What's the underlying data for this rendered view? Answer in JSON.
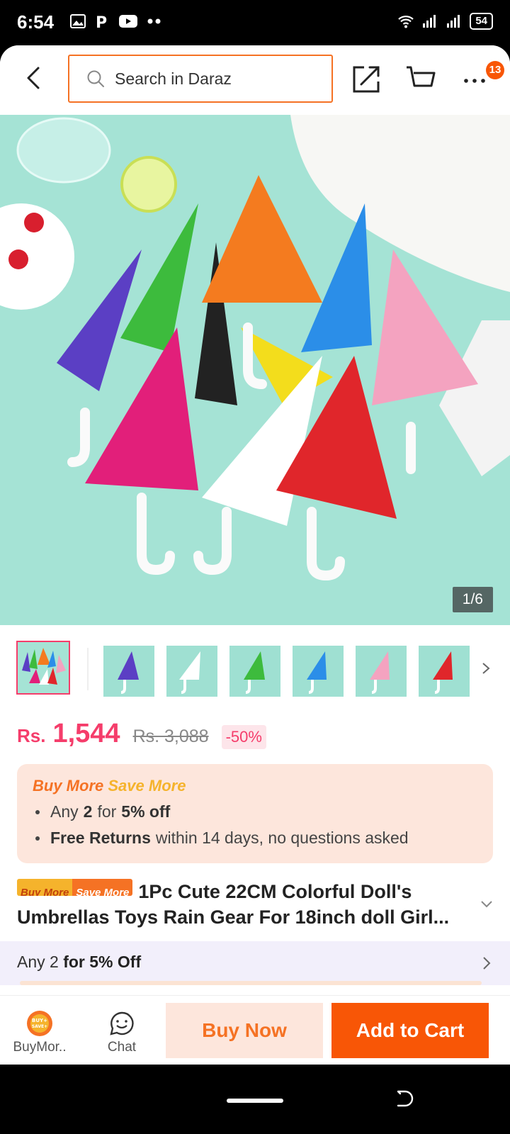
{
  "status_bar": {
    "time": "6:54",
    "battery": "54",
    "icons": [
      "gallery-icon",
      "parking-icon",
      "youtube-icon",
      "dots-icon",
      "wifi-icon",
      "signal-icon",
      "signal-icon"
    ]
  },
  "header": {
    "search_placeholder": "Search in Daraz",
    "cart_badge": "13",
    "icons": [
      "back-arrow-icon",
      "search-icon",
      "share-icon",
      "cart-icon",
      "more-icon"
    ]
  },
  "gallery": {
    "counter": "1/6",
    "thumbnail_colors": [
      "#5b3fc4",
      "#ffffff",
      "#3dbb3d",
      "#2b8ee8",
      "#f4a3c0",
      "#e0262b"
    ]
  },
  "price": {
    "currency": "Rs.",
    "current": "1,544",
    "original": "Rs. 3,088",
    "discount": "-50%"
  },
  "promo": {
    "title_part1": "Buy More",
    "title_part2": "Save More",
    "line1_a": "Any",
    "line1_b": "2",
    "line1_c": "for",
    "line1_d": "5% off",
    "line2_a": "Free Returns",
    "line2_b": "within 14 days, no questions asked"
  },
  "product": {
    "tag_part1": "Buy More",
    "tag_part2": "Save More",
    "title": "1Pc Cute 22CM Colorful Doll's Umbrellas Toys Rain Gear For 18inch doll Girl..."
  },
  "strip": {
    "text_a": "Any 2",
    "text_b": "for 5% Off"
  },
  "bottom_bar": {
    "buymore_label": "BuyMor..",
    "chat_label": "Chat",
    "buymore_icon_text": "BUY+ SAVE+",
    "buy_now": "Buy Now",
    "add_to_cart": "Add to Cart",
    "accent": "#f85606"
  }
}
